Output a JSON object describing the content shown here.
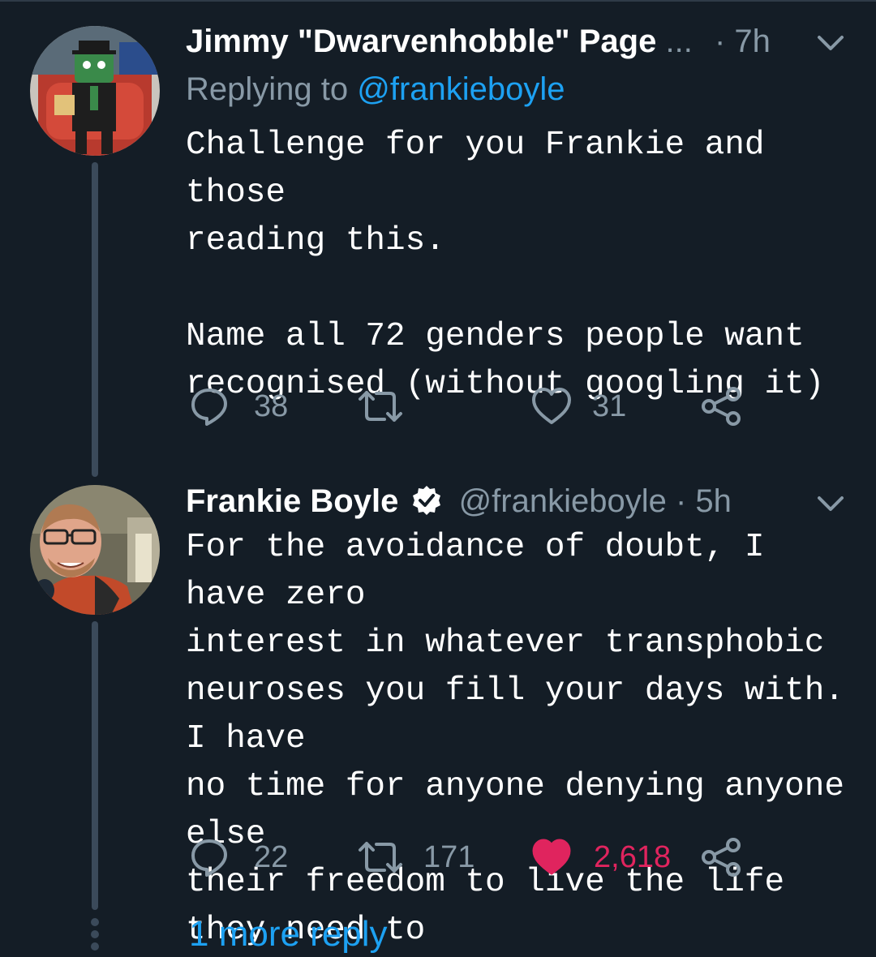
{
  "tweet1": {
    "name": "Jimmy \"Dwarvenhobble\" Page",
    "ellipsis": "...",
    "time": "· 7h",
    "replying_prefix": "Replying to",
    "replying_handle": "@frankieboyle",
    "body": "Challenge for you Frankie and those\nreading this.\n\nName all 72 genders people want\nrecognised (without googling it)",
    "reply_count": "38",
    "retweet_count": "",
    "like_count": "31"
  },
  "tweet2": {
    "name": "Frankie Boyle",
    "verified": true,
    "handle": "@frankieboyle",
    "time": "· 5h",
    "body": "For the avoidance of doubt, I have zero\ninterest in whatever transphobic\nneuroses you fill your days with. I have\nno time for anyone denying anyone else\ntheir freedom to live the life they need to\nlive. Gtf.",
    "reply_count": "22",
    "retweet_count": "171",
    "like_count": "2,618",
    "liked": true
  },
  "more_replies": "1 more reply",
  "colors": {
    "background": "#141d26",
    "muted": "#8899a6",
    "link": "#1da1f2",
    "like": "#e0245e",
    "thread_line": "#3b4a5a"
  }
}
